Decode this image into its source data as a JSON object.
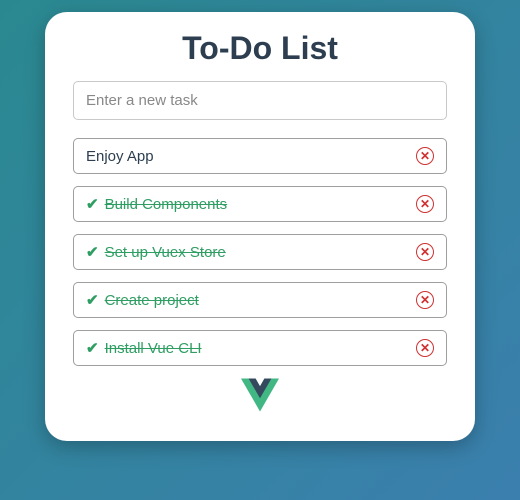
{
  "title": "To-Do List",
  "input": {
    "placeholder": "Enter a new task"
  },
  "tasks": [
    {
      "label": "Enjoy App",
      "done": false
    },
    {
      "label": "Build Components",
      "done": true
    },
    {
      "label": "Set up Vuex Store",
      "done": true
    },
    {
      "label": "Create project",
      "done": true
    },
    {
      "label": "Install Vue CLI",
      "done": true
    }
  ],
  "icons": {
    "check": "✔",
    "delete": "✕"
  },
  "logo": "vue-logo"
}
